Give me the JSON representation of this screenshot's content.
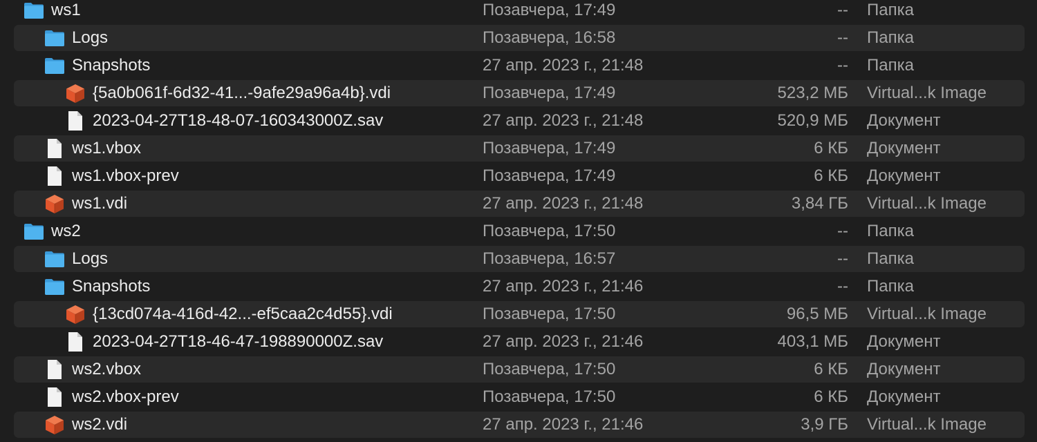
{
  "colors": {
    "folder": "#4fb3ef",
    "folder_back": "#3a9ad9",
    "vdi_cube": "#e2552c",
    "document": "#f2f2f2",
    "secondary_text": "#a4a4a4",
    "stripe": "#2a2a2a"
  },
  "rows": [
    {
      "name": "ws1",
      "date": "Позавчера, 17:49",
      "size": "--",
      "kind": "Папка",
      "icon": "folder-icon",
      "chevron": "expanded",
      "depth": 0
    },
    {
      "name": "Logs",
      "date": "Позавчера, 16:58",
      "size": "--",
      "kind": "Папка",
      "icon": "folder-icon",
      "chevron": "collapsed",
      "depth": 1
    },
    {
      "name": "Snapshots",
      "date": "27 апр. 2023 г., 21:48",
      "size": "--",
      "kind": "Папка",
      "icon": "folder-icon",
      "chevron": "expanded",
      "depth": 1
    },
    {
      "name": "{5a0b061f-6d32-41...-9afe29a96a4b}.vdi",
      "date": "Позавчера, 17:49",
      "size": "523,2 МБ",
      "kind": "Virtual...k Image",
      "icon": "vdi-cube-icon",
      "chevron": "none",
      "depth": 2
    },
    {
      "name": "2023-04-27T18-48-07-160343000Z.sav",
      "date": "27 апр. 2023 г., 21:48",
      "size": "520,9 МБ",
      "kind": "Документ",
      "icon": "document-icon",
      "chevron": "none",
      "depth": 2
    },
    {
      "name": "ws1.vbox",
      "date": "Позавчера, 17:49",
      "size": "6 КБ",
      "kind": "Документ",
      "icon": "document-icon",
      "chevron": "none",
      "depth": 1
    },
    {
      "name": "ws1.vbox-prev",
      "date": "Позавчера, 17:49",
      "size": "6 КБ",
      "kind": "Документ",
      "icon": "document-icon",
      "chevron": "none",
      "depth": 1
    },
    {
      "name": "ws1.vdi",
      "date": "27 апр. 2023 г., 21:48",
      "size": "3,84 ГБ",
      "kind": "Virtual...k Image",
      "icon": "vdi-cube-icon",
      "chevron": "none",
      "depth": 1
    },
    {
      "name": "ws2",
      "date": "Позавчера, 17:50",
      "size": "--",
      "kind": "Папка",
      "icon": "folder-icon",
      "chevron": "expanded",
      "depth": 0
    },
    {
      "name": "Logs",
      "date": "Позавчера, 16:57",
      "size": "--",
      "kind": "Папка",
      "icon": "folder-icon",
      "chevron": "collapsed",
      "depth": 1
    },
    {
      "name": "Snapshots",
      "date": "27 апр. 2023 г., 21:46",
      "size": "--",
      "kind": "Папка",
      "icon": "folder-icon",
      "chevron": "expanded",
      "depth": 1
    },
    {
      "name": "{13cd074a-416d-42...-ef5caa2c4d55}.vdi",
      "date": "Позавчера, 17:50",
      "size": "96,5 МБ",
      "kind": "Virtual...k Image",
      "icon": "vdi-cube-icon",
      "chevron": "none",
      "depth": 2
    },
    {
      "name": "2023-04-27T18-46-47-198890000Z.sav",
      "date": "27 апр. 2023 г., 21:46",
      "size": "403,1 МБ",
      "kind": "Документ",
      "icon": "document-icon",
      "chevron": "none",
      "depth": 2
    },
    {
      "name": "ws2.vbox",
      "date": "Позавчера, 17:50",
      "size": "6 КБ",
      "kind": "Документ",
      "icon": "document-icon",
      "chevron": "none",
      "depth": 1
    },
    {
      "name": "ws2.vbox-prev",
      "date": "Позавчера, 17:50",
      "size": "6 КБ",
      "kind": "Документ",
      "icon": "document-icon",
      "chevron": "none",
      "depth": 1
    },
    {
      "name": "ws2.vdi",
      "date": "27 апр. 2023 г., 21:46",
      "size": "3,9 ГБ",
      "kind": "Virtual...k Image",
      "icon": "vdi-cube-icon",
      "chevron": "none",
      "depth": 1
    }
  ]
}
